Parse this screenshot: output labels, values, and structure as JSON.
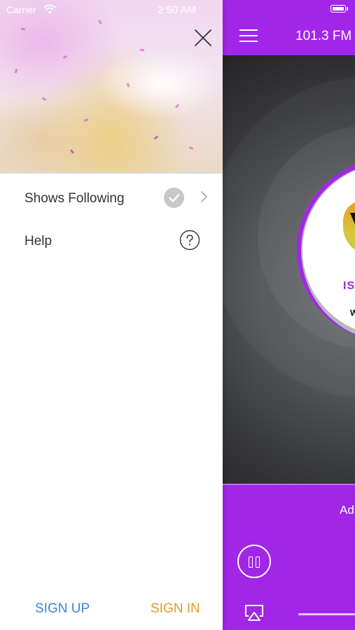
{
  "status_bar": {
    "carrier": "Carrier",
    "time": "2:50 AM"
  },
  "drawer": {
    "menu_items": [
      {
        "label": "Shows Following",
        "icon": "check-circle-icon",
        "trailing_icon": "chevron-right-icon"
      },
      {
        "label": "Help",
        "icon": "question-circle-icon"
      }
    ],
    "sign_up_label": "SIGN UP",
    "sign_in_label": "SIGN IN",
    "close_icon": "close-icon"
  },
  "player": {
    "station_title": "101.3 FM",
    "menu_icon": "hamburger-menu-icon",
    "logo_tagline_partial": "IS A",
    "logo_sub_partial": "W",
    "ad_label_partial": "Ad",
    "pause_icon": "pause-icon",
    "airplay_icon": "airplay-icon",
    "accent_color": "#a226e8"
  },
  "colors": {
    "sign_up": "#3a86d9",
    "sign_in": "#e39a2c",
    "menu_text": "#333333",
    "check_badge": "#c8c8c8"
  }
}
